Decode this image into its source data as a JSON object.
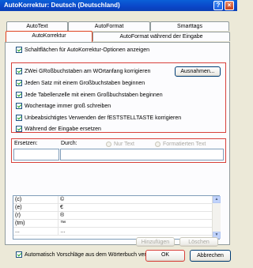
{
  "window": {
    "title": "AutoKorrektur: Deutsch (Deutschland)",
    "help": "?",
    "close": "×"
  },
  "tabs": [
    {
      "label": "AutoText"
    },
    {
      "label": "AutoFormat"
    },
    {
      "label": "Smarttags"
    },
    {
      "label": "AutoKorrektur"
    },
    {
      "label": "AutoFormat während der Eingabe"
    }
  ],
  "options": {
    "show_buttons": "Schaltflächen für AutoKorrektur-Optionen anzeigen",
    "two_caps": "ZWei GRoßbuchstaben am WOrtanfang korrigieren",
    "sentence": "Jeden Satz mit einem Großbuchstaben beginnen",
    "table_cell": "Jede Tabellenzelle mit einem Großbuchstaben beginnen",
    "weekdays": "Wochentage immer groß schreiben",
    "capslock": "Unbeabsichtigtes Verwenden der fESTSTELLTASTE korrigieren",
    "while_typing": "Während der Eingabe ersetzen",
    "exceptions_button": "Ausnahmen..."
  },
  "replace": {
    "replace_label": "Ersetzen:",
    "with_label": "Durch:",
    "plain_text": "Nur Text",
    "formatted_text": "Formatierten Text"
  },
  "entries": [
    {
      "from": "(c)",
      "to": "©"
    },
    {
      "from": "(e)",
      "to": "€"
    },
    {
      "from": "(r)",
      "to": "®"
    },
    {
      "from": "(tm)",
      "to": "™"
    },
    {
      "from": "...",
      "to": "…"
    }
  ],
  "actions": {
    "add": "Hinzufügen",
    "delete": "Löschen",
    "dictionary": "Automatisch Vorschläge aus dem Wörterbuch verwenden",
    "ok": "OK",
    "cancel": "Abbrechen"
  },
  "colors": {
    "title_bar": "#0a46c8",
    "highlight": "#d8403a",
    "dialog_bg": "#ece9d8"
  }
}
